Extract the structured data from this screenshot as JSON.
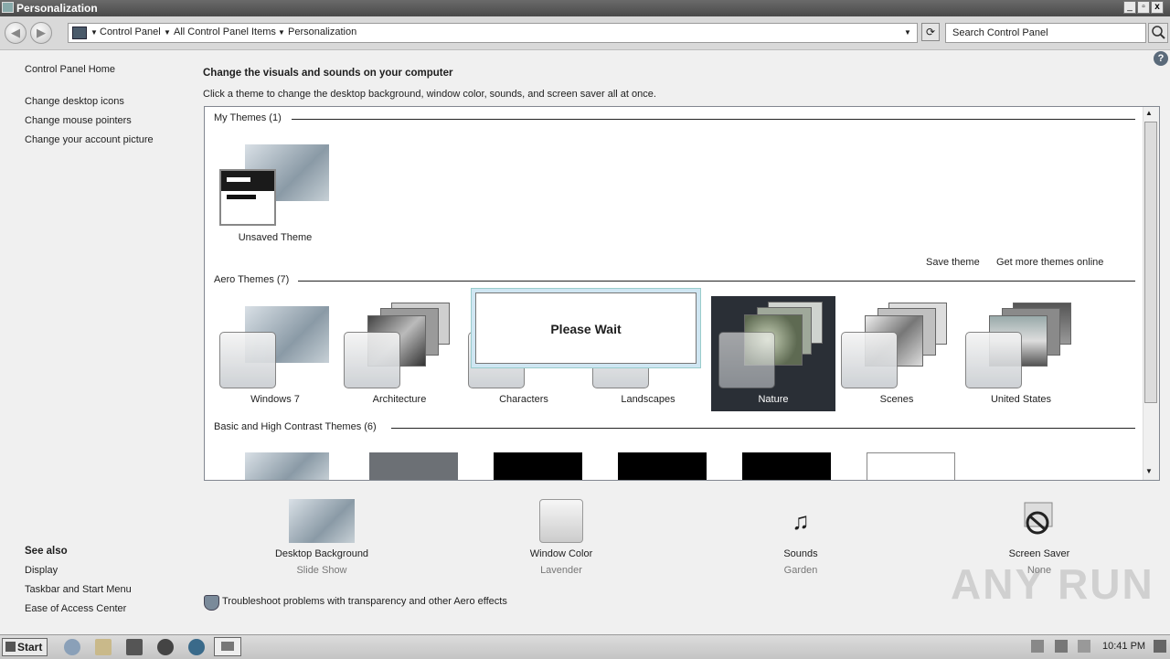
{
  "window": {
    "title": "Personalization",
    "min": "_",
    "max": "▫",
    "close": "x"
  },
  "address": {
    "crumbs": [
      "Control Panel",
      "All Control Panel Items",
      "Personalization"
    ],
    "refresh": "⟳"
  },
  "search": {
    "placeholder": "Search Control Panel"
  },
  "help": "?",
  "sidebar": {
    "home": "Control Panel Home",
    "links": [
      "Change desktop icons",
      "Change mouse pointers",
      "Change your account picture"
    ],
    "see_also_title": "See also",
    "see_also": [
      "Display",
      "Taskbar and Start Menu",
      "Ease of Access Center"
    ]
  },
  "main": {
    "heading": "Change the visuals and sounds on your computer",
    "subheading": "Click a theme to change the desktop background, window color, sounds, and screen saver all at once.",
    "my_themes_title": "My Themes (1)",
    "unsaved_theme": "Unsaved Theme",
    "save_theme": "Save theme",
    "get_more": "Get more themes online",
    "aero_title": "Aero Themes (7)",
    "aero": [
      "Windows 7",
      "Architecture",
      "Characters",
      "Landscapes",
      "Nature",
      "Scenes",
      "United States"
    ],
    "selected_aero": "Nature",
    "basic_title": "Basic and High Contrast Themes (6)",
    "please_wait": "Please Wait"
  },
  "bottom": {
    "items": [
      {
        "label": "Desktop Background",
        "value": "Slide Show"
      },
      {
        "label": "Window Color",
        "value": "Lavender"
      },
      {
        "label": "Sounds",
        "value": "Garden"
      },
      {
        "label": "Screen Saver",
        "value": "None"
      }
    ],
    "troubleshoot": "Troubleshoot problems with transparency and other Aero effects"
  },
  "taskbar": {
    "start": "Start",
    "clock": "10:41 PM"
  },
  "watermark": "ANY RUN"
}
